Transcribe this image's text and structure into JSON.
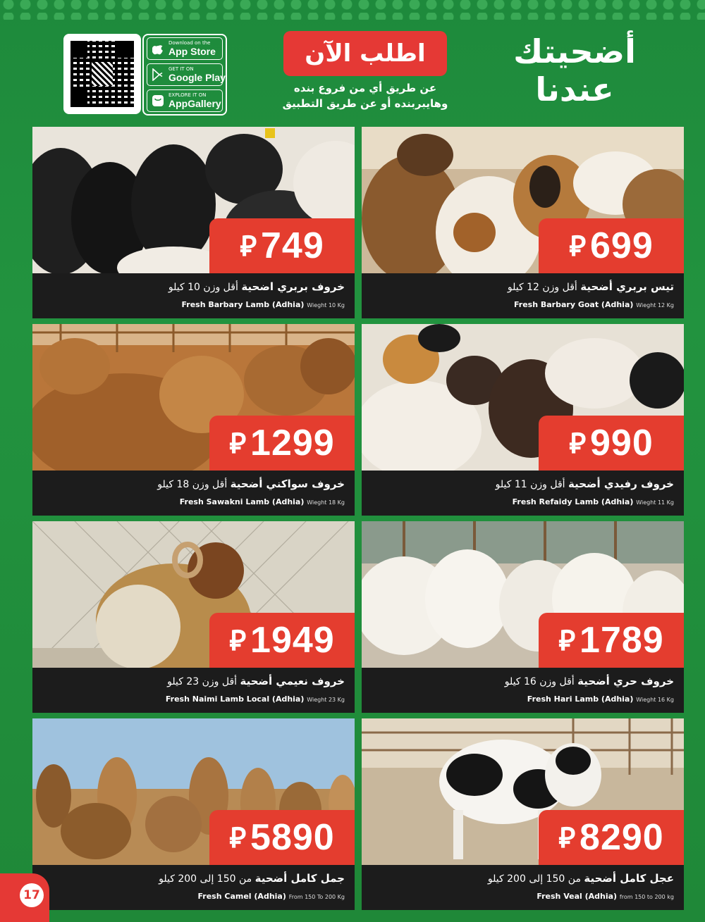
{
  "header": {
    "stores": [
      {
        "icon": "apple-icon",
        "small": "Download on the",
        "big": "App Store"
      },
      {
        "icon": "google-play-icon",
        "small": "GET IT ON",
        "big": "Google Play"
      },
      {
        "icon": "appgallery-icon",
        "small": "EXPLORE IT ON",
        "big": "AppGallery"
      }
    ],
    "order_now": "اطلب الآن",
    "order_sub_1": "عن طريق أي من فروع بنده",
    "order_sub_2": "وهايبربنده أو عن طريق التطبيق",
    "brand_line1": "أضحيتك",
    "brand_line2": "عندنا"
  },
  "currency_symbol": "⃁",
  "products": [
    {
      "price": "699",
      "ar_name": "تيس بربري أضحية",
      "ar_weight": "أقل وزن 12 كيلو",
      "en_name": "Fresh Barbary Goat (Adhia)",
      "en_weight": "Wieght 12 Kg"
    },
    {
      "price": "749",
      "ar_name": "خروف بربري اضحية",
      "ar_weight": "أقل وزن 10 كيلو",
      "en_name": "Fresh Barbary Lamb (Adhia)",
      "en_weight": "Wieght 10 Kg"
    },
    {
      "price": "990",
      "ar_name": "خروف رفيدي أضحية",
      "ar_weight": "أقل وزن 11 كيلو",
      "en_name": "Fresh Refaidy Lamb (Adhia)",
      "en_weight": "Wieght 11 Kg"
    },
    {
      "price": "1299",
      "ar_name": "خروف سواكني أضحية",
      "ar_weight": "أقل وزن 18 كيلو",
      "en_name": "Fresh Sawakni Lamb (Adhia)",
      "en_weight": "Wieght 18 Kg"
    },
    {
      "price": "1789",
      "ar_name": "خروف حري أضحية",
      "ar_weight": "أقل وزن 16 كيلو",
      "en_name": "Fresh Hari Lamb (Adhia)",
      "en_weight": "Wieght 16 Kg"
    },
    {
      "price": "1949",
      "ar_name": "خروف نعيمي أضحية",
      "ar_weight": "أقل وزن 23 كيلو",
      "en_name": "Fresh Naimi Lamb Local (Adhia)",
      "en_weight": "Wieght 23 Kg"
    },
    {
      "price": "8290",
      "ar_name": "عجل كامل أضحية",
      "ar_weight": "من 150 إلى 200 كيلو",
      "en_name": "Fresh Veal (Adhia)",
      "en_weight": "from 150 to 200 kg"
    },
    {
      "price": "5890",
      "ar_name": "جمل كامل أضحية",
      "ar_weight": "من 150 إلى 200 كيلو",
      "en_name": "Fresh Camel (Adhia)",
      "en_weight": "From 150 To 200 Kg"
    }
  ],
  "page_number": "17",
  "colors": {
    "green": "#1e8a3c",
    "red": "#e43d2f",
    "dark": "#1c1c1c"
  }
}
